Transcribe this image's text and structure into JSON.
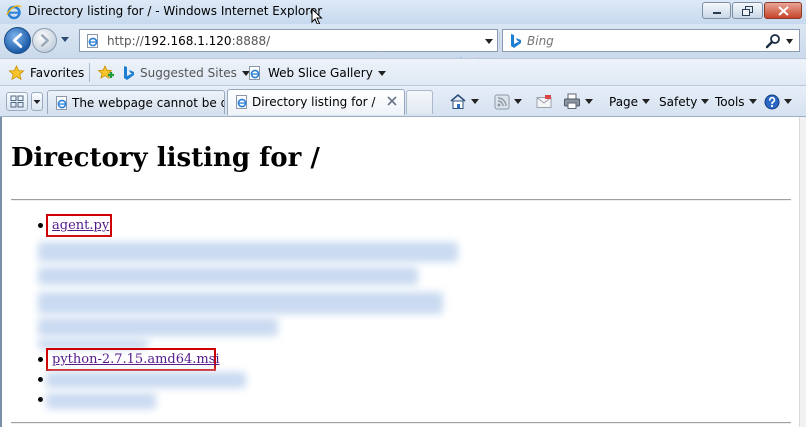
{
  "window": {
    "title": "Directory listing for / - Windows Internet Explorer"
  },
  "address_bar": {
    "prefix": "http://",
    "host": "192.168.1.120",
    "suffix": ":8888/"
  },
  "search": {
    "placeholder": "Bing"
  },
  "favorites_bar": {
    "favorites_label": "Favorites",
    "suggested_sites_label": "Suggested Sites",
    "web_slice_gallery_label": "Web Slice Gallery"
  },
  "tabs": [
    {
      "label": "The webpage cannot be di...",
      "active": false
    },
    {
      "label": "Directory listing for /",
      "active": true
    }
  ],
  "command_bar": {
    "page_label": "Page",
    "safety_label": "Safety",
    "tools_label": "Tools"
  },
  "content": {
    "heading": "Directory listing for /",
    "files": [
      {
        "name": "agent.py",
        "highlighted": true
      },
      {
        "name": "python-2.7.15.amd64.msi",
        "highlighted": true
      }
    ]
  },
  "colors": {
    "link_visited": "#551a8b",
    "highlight_box": "#d00000"
  }
}
